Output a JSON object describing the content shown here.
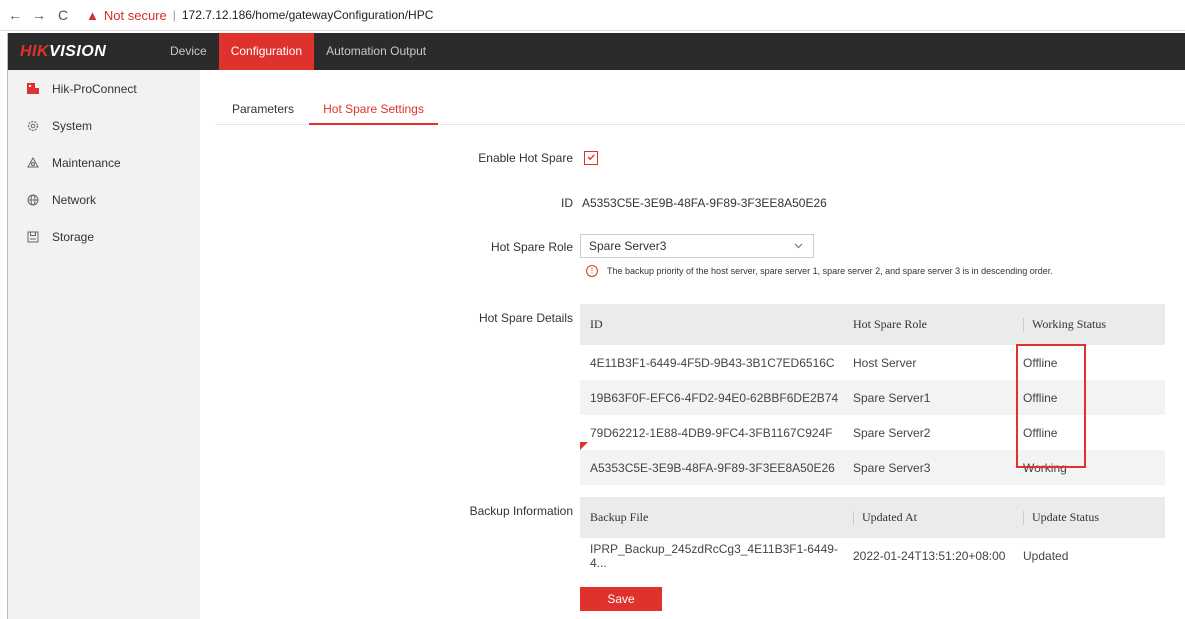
{
  "browser": {
    "back": "←",
    "forward": "→",
    "reload": "C",
    "warning_icon": "▲",
    "not_secure": "Not secure",
    "separator": "|",
    "url": "172.7.12.186/home/gatewayConfiguration/HPC"
  },
  "topnav": {
    "logo_red": "HIK",
    "logo_white": "VISION",
    "items": [
      "Device",
      "Configuration",
      "Automation Output"
    ],
    "active": "Configuration"
  },
  "sidebar": {
    "items": [
      {
        "label": "Hik-ProConnect",
        "icon": "hikproconnect-icon"
      },
      {
        "label": "System",
        "icon": "gear-icon"
      },
      {
        "label": "Maintenance",
        "icon": "maintenance-icon"
      },
      {
        "label": "Network",
        "icon": "globe-icon"
      },
      {
        "label": "Storage",
        "icon": "storage-icon"
      }
    ]
  },
  "tabs": {
    "items": [
      "Parameters",
      "Hot Spare Settings"
    ],
    "active": "Hot Spare Settings"
  },
  "form": {
    "enable_label": "Enable Hot Spare",
    "enable_checked": true,
    "id_label": "ID",
    "id_value": "A5353C5E-3E9B-48FA-9F89-3F3EE8A50E26",
    "role_label": "Hot Spare Role",
    "role_value": "Spare Server3",
    "note": "The backup priority of the host server, spare server 1, spare server 2, and spare server 3 is in descending order.",
    "details_label": "Hot Spare Details",
    "backup_label": "Backup Information",
    "save_label": "Save"
  },
  "details_table": {
    "headers": [
      "ID",
      "Hot Spare Role",
      "Working Status"
    ],
    "rows": [
      [
        "4E11B3F1-6449-4F5D-9B43-3B1C7ED6516C",
        "Host Server",
        "Offline"
      ],
      [
        "19B63F0F-EFC6-4FD2-94E0-62BBF6DE2B74",
        "Spare Server1",
        "Offline"
      ],
      [
        "79D62212-1E88-4DB9-9FC4-3FB1167C924F",
        "Spare Server2",
        "Offline"
      ],
      [
        "A5353C5E-3E9B-48FA-9F89-3F3EE8A50E26",
        "Spare Server3",
        "Working"
      ]
    ]
  },
  "backup_table": {
    "headers": [
      "Backup File",
      "Updated At",
      "Update Status"
    ],
    "rows": [
      [
        "IPRP_Backup_245zdRcCg3_4E11B3F1-6449-4...",
        "2022-01-24T13:51:20+08:00",
        "Updated"
      ]
    ]
  },
  "colors": {
    "accent": "#e0322c",
    "topbar": "#2b2b2b",
    "sidebar": "#f2f2f2"
  }
}
